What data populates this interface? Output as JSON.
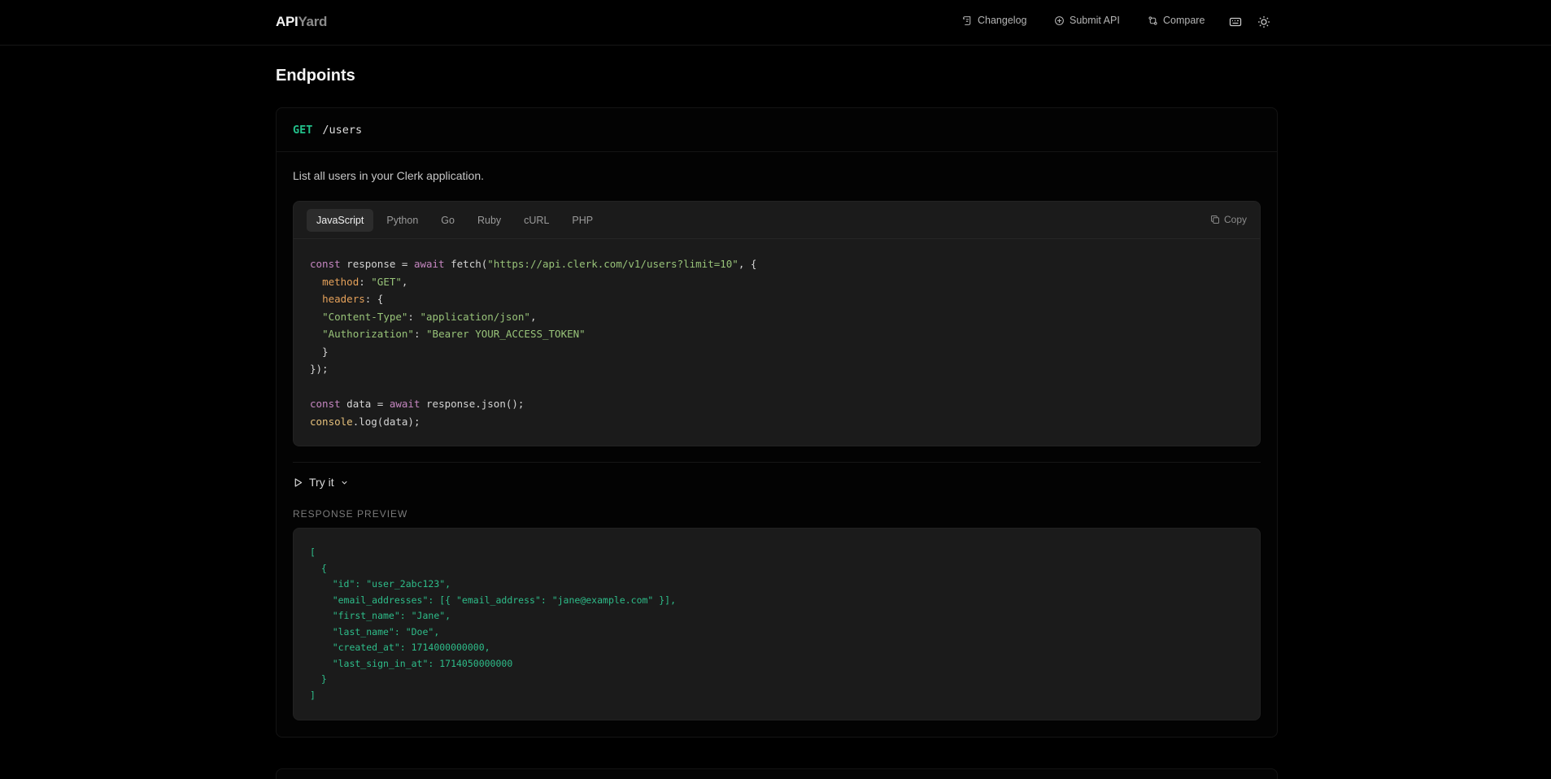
{
  "header": {
    "logo_primary": "API",
    "logo_secondary": "Yard",
    "nav": [
      {
        "label": "Changelog",
        "icon": "scroll-icon"
      },
      {
        "label": "Submit API",
        "icon": "plus-circle-icon"
      },
      {
        "label": "Compare",
        "icon": "git-compare-icon"
      }
    ],
    "keyboard_icon": "keyboard-icon",
    "theme_icon": "sun-icon"
  },
  "page": {
    "title": "Endpoints"
  },
  "endpoint": {
    "method": "GET",
    "path": "/users",
    "description": "List all users in your Clerk application.",
    "code_tabs": [
      "JavaScript",
      "Python",
      "Go",
      "Ruby",
      "cURL",
      "PHP"
    ],
    "active_tab": "JavaScript",
    "copy_label": "Copy",
    "code_lines": [
      "const response = await fetch(\"https://api.clerk.com/v1/users?limit=10\", {",
      "  method: \"GET\",",
      "  headers: {",
      "  \"Content-Type\": \"application/json\",",
      "  \"Authorization\": \"Bearer YOUR_ACCESS_TOKEN\"",
      "  }",
      "});",
      "",
      "const data = await response.json();",
      "console.log(data);"
    ],
    "try_it_label": "Try it",
    "response_label": "RESPONSE PREVIEW",
    "response_lines": [
      "[",
      "  {",
      "    \"id\": \"user_2abc123\",",
      "    \"email_addresses\": [{ \"email_address\": \"jane@example.com\" }],",
      "    \"first_name\": \"Jane\",",
      "    \"last_name\": \"Doe\",",
      "    \"created_at\": 1714000000000,",
      "    \"last_sign_in_at\": 1714050000000",
      "  }",
      "]"
    ]
  },
  "colors": {
    "background": "#000000",
    "method_get": "#22c08a",
    "response_text": "#2ebd8a",
    "code_keyword": "#c586c0",
    "code_string": "#98c379"
  }
}
